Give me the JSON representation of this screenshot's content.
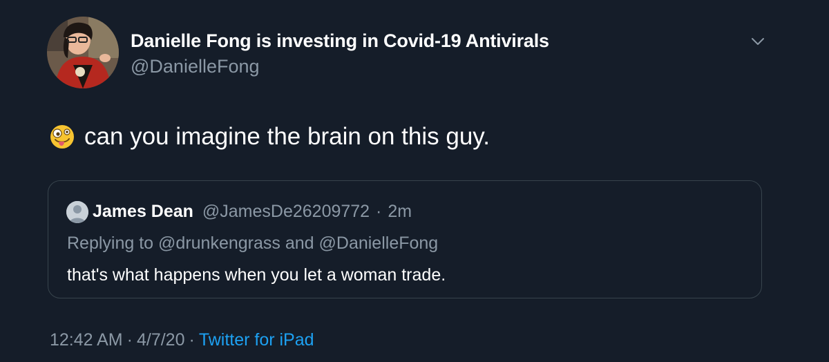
{
  "author": {
    "display_name": "Danielle Fong is investing in Covid-19 Antivirals",
    "handle": "@DanielleFong"
  },
  "tweet": {
    "emoji": "zany-face",
    "text": "can you imagine the brain on this guy."
  },
  "quoted_tweet": {
    "name": "James Dean",
    "handle": "@JamesDe26209772",
    "separator": "·",
    "time": "2m",
    "reply_prefix": "Replying to",
    "reply_user_1": "@drunkengrass",
    "reply_and": "and",
    "reply_user_2": "@DanielleFong",
    "text": "that's what happens when you let a woman trade."
  },
  "meta": {
    "time": "12:42 AM",
    "separator_1": "·",
    "date": "4/7/20",
    "separator_2": "·",
    "source": "Twitter for iPad"
  },
  "colors": {
    "background": "#151d29",
    "text_primary": "#ffffff",
    "text_secondary": "#8b98a5",
    "link": "#1da1f2",
    "border": "#38444d"
  }
}
